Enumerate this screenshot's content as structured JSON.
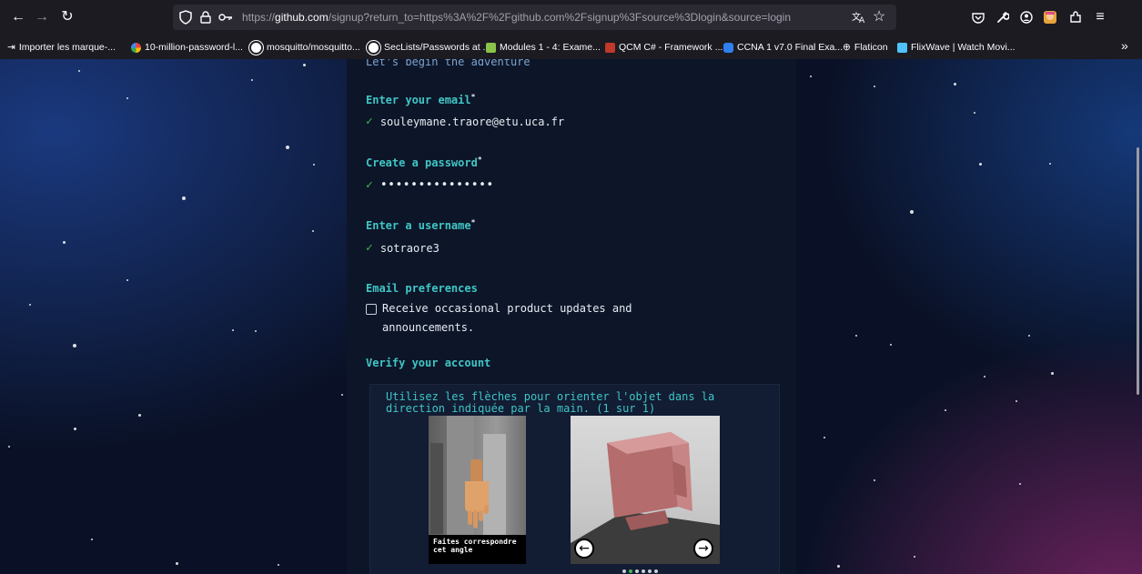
{
  "browser": {
    "url_prefix": "https://",
    "url_domain": "github.com",
    "url_rest": "/signup?return_to=https%3A%2F%2Fgithub.com%2Fsignup%3Fsource%3Dlogin&source=login",
    "bookmarks": [
      {
        "label": "Importer les marque-...",
        "icon": "import-icon",
        "color": "#fbfbfe"
      },
      {
        "label": "10-million-password-l...",
        "icon": "google-icon",
        "color": "#ffffff"
      },
      {
        "label": "mosquitto/mosquitto...",
        "icon": "github-icon",
        "color": "#ffffff"
      },
      {
        "label": "SecLists/Passwords at ...",
        "icon": "github-icon",
        "color": "#ffffff"
      },
      {
        "label": "Modules 1 - 4: Exame...",
        "icon": "page-icon",
        "color": "#8bc34a"
      },
      {
        "label": "QCM C# - Framework ...",
        "icon": "page-icon",
        "color": "#c0392b"
      },
      {
        "label": "CCNA 1 v7.0 Final Exa...",
        "icon": "page-icon",
        "color": "#2f80ed"
      },
      {
        "label": "Flaticon",
        "icon": "globe-icon",
        "color": "#fbfbfe"
      },
      {
        "label": "FlixWave | Watch Movi...",
        "icon": "page-icon",
        "color": "#4fc3f7"
      }
    ],
    "overflow_label": "»"
  },
  "signup": {
    "subtitle": "Let's begin the adventure",
    "email_label": "Enter your email",
    "email_value": "souleymane.traore@etu.uca.fr",
    "password_label": "Create a password",
    "password_value": "•••••••••••••••",
    "username_label": "Enter a username",
    "username_value": "sotraore3",
    "required_mark": "*",
    "check_mark": "✓",
    "prefs_heading": "Email preferences",
    "prefs_checkbox_label": "Receive occasional product updates and announcements.",
    "prefs_checked": false,
    "verify_heading": "Verify your account"
  },
  "captcha": {
    "instruction": "Utilisez les flèches pour orienter l'objet dans la direction indiquée par la main. (1 sur 1)",
    "hand_caption": "Faites correspondre cet angle",
    "left_arrow": "←",
    "right_arrow": "→",
    "dots_total": 6,
    "dots_active_index": 1
  }
}
